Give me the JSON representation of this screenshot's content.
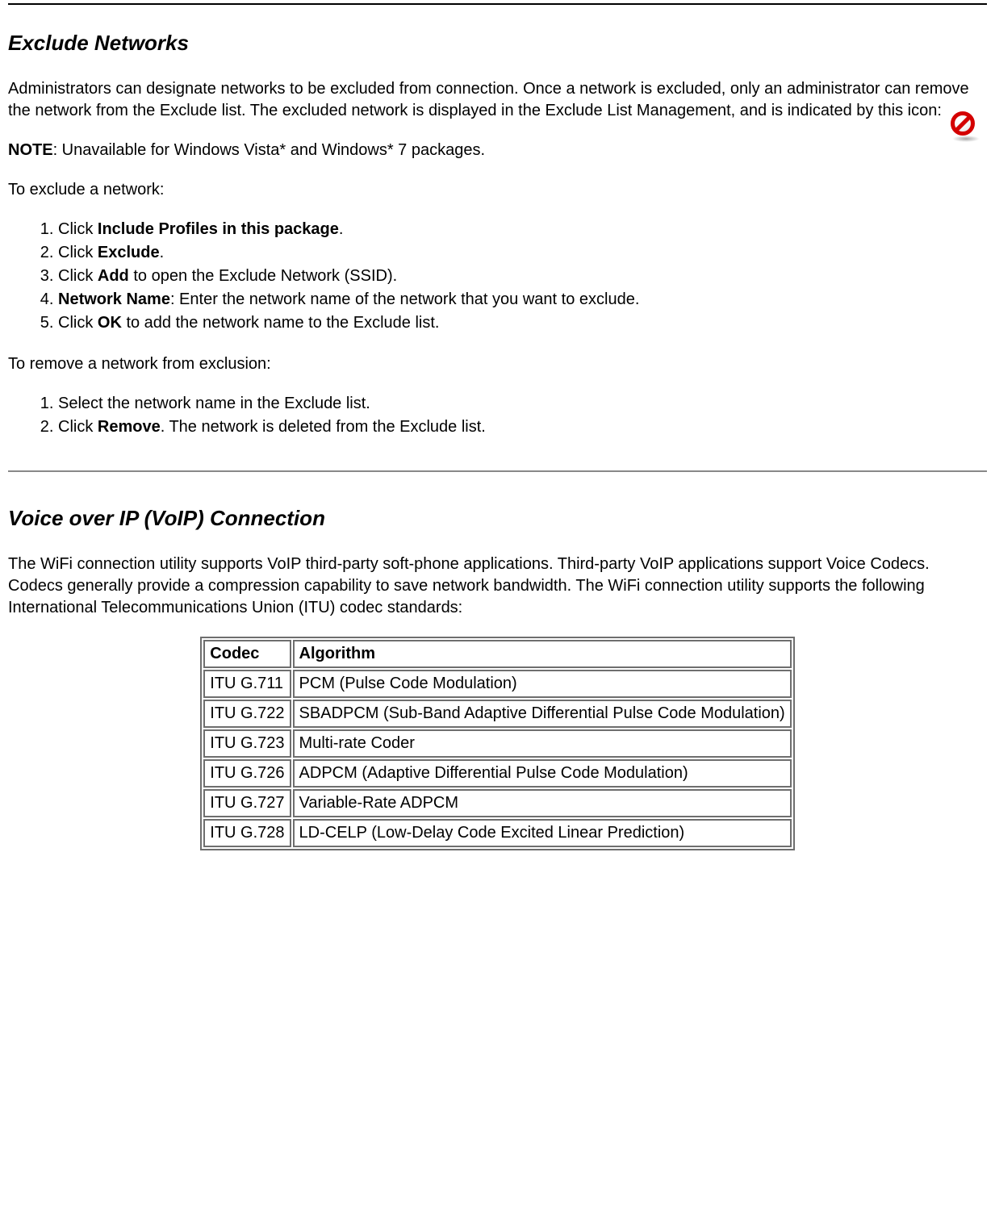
{
  "section1": {
    "heading": "Exclude Networks",
    "intro_before_icon": "Administrators can designate networks to be excluded from connection. Once a network is excluded, only an administrator can remove the network from the Exclude list. The excluded network is displayed in the Exclude List Management, and is indicated by this icon:",
    "note_label": "NOTE",
    "note_text": ": Unavailable for Windows Vista* and Windows* 7 packages.",
    "exclude_lead": "To exclude a network:",
    "exclude_steps": [
      {
        "pre": "Click ",
        "bold": "Include Profiles in this package",
        "post": "."
      },
      {
        "pre": "Click ",
        "bold": "Exclude",
        "post": "."
      },
      {
        "pre": "Click ",
        "bold": "Add",
        "post": " to open the Exclude Network (SSID)."
      },
      {
        "pre": "",
        "bold": "Network Name",
        "post": ": Enter the network name of the network that you want to exclude."
      },
      {
        "pre": "Click ",
        "bold": "OK",
        "post": " to add the network name to the Exclude list."
      }
    ],
    "remove_lead": "To remove a network from exclusion:",
    "remove_steps": [
      {
        "pre": "Select the network name in the Exclude list.",
        "bold": "",
        "post": ""
      },
      {
        "pre": "Click ",
        "bold": "Remove",
        "post": ". The network is deleted from the Exclude list."
      }
    ]
  },
  "section2": {
    "heading": "Voice over IP (VoIP) Connection",
    "intro": "The WiFi connection utility supports VoIP third-party soft-phone applications. Third-party VoIP applications support Voice Codecs. Codecs generally provide a compression capability to save network bandwidth. The WiFi connection utility supports the following International Telecommunications Union (ITU) codec standards:",
    "table": {
      "headers": [
        "Codec",
        "Algorithm"
      ],
      "rows": [
        [
          "ITU G.711",
          "PCM (Pulse Code Modulation)"
        ],
        [
          "ITU G.722",
          "SBADPCM (Sub-Band Adaptive Differential Pulse Code Modulation)"
        ],
        [
          "ITU G.723",
          "Multi-rate Coder"
        ],
        [
          "ITU G.726",
          "ADPCM (Adaptive Differential Pulse Code Modulation)"
        ],
        [
          "ITU G.727",
          "Variable-Rate ADPCM"
        ],
        [
          "ITU G.728",
          "LD-CELP (Low-Delay Code Excited Linear Prediction)"
        ]
      ]
    }
  }
}
